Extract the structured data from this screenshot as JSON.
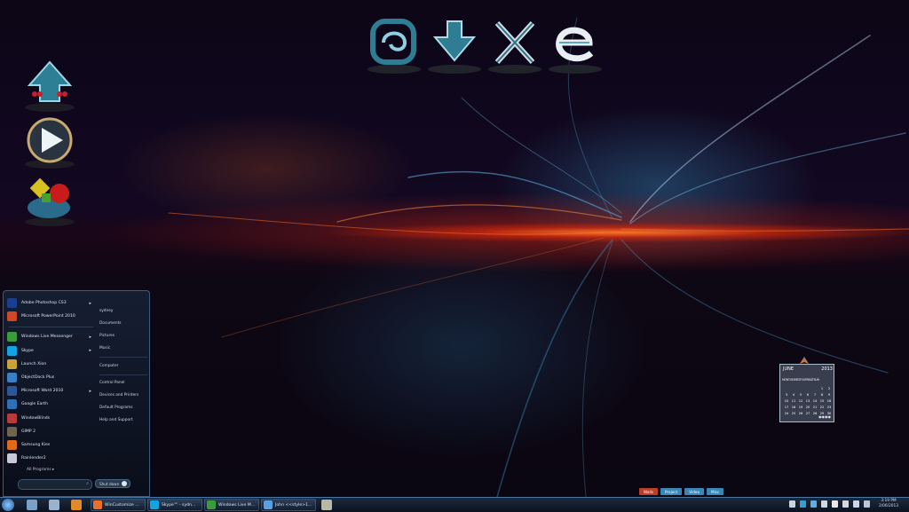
{
  "desktop": {
    "left_icons": [
      "upload-icon",
      "play-icon",
      "game-icon"
    ],
    "dock_icons": [
      "launch-icon",
      "download-icon",
      "crossed-tools-icon",
      "browser-e-icon"
    ]
  },
  "start_menu": {
    "programs": [
      {
        "label": "Adobe Photoshop CS3",
        "icon": "photoshop-icon",
        "color": "#1b3f8f",
        "submenu": true
      },
      {
        "label": "Microsoft PowerPoint 2010",
        "icon": "powerpoint-icon",
        "color": "#d24726",
        "submenu": false
      },
      {
        "label": "Windows Live Messenger",
        "icon": "messenger-icon",
        "color": "#3a9c3a",
        "submenu": true
      },
      {
        "label": "Skype",
        "icon": "skype-icon",
        "color": "#12a5e3",
        "submenu": true
      },
      {
        "label": "Launch Xion",
        "icon": "xion-icon",
        "color": "#c9a33a",
        "submenu": false
      },
      {
        "label": "ObjectDock Plus",
        "icon": "objectdock-icon",
        "color": "#3a7fc4",
        "submenu": false
      },
      {
        "label": "Microsoft Word 2010",
        "icon": "word-icon",
        "color": "#2b5797",
        "submenu": true
      },
      {
        "label": "Google Earth",
        "icon": "google-earth-icon",
        "color": "#2f6fb6",
        "submenu": false
      },
      {
        "label": "WindowBlinds",
        "icon": "windowblinds-icon",
        "color": "#b83a3a",
        "submenu": false
      },
      {
        "label": "GIMP 2",
        "icon": "gimp-icon",
        "color": "#6e6450",
        "submenu": false
      },
      {
        "label": "Samsung Kies",
        "icon": "samsung-kies-icon",
        "color": "#e06a1a",
        "submenu": false
      },
      {
        "label": "Rainlender2",
        "icon": "rainlendar-icon",
        "color": "#c8c8d8",
        "submenu": false
      }
    ],
    "places": [
      "sydney",
      "Documents",
      "Pictures",
      "Music",
      "Computer",
      "Control Panel",
      "Devices and Printers",
      "Default Programs",
      "Help and Support"
    ],
    "all_programs": "All Programs",
    "shutdown": "Shut down"
  },
  "taskbar": {
    "pinned": [
      {
        "icon": "quick-launch-icon",
        "color": "#7aa0c8"
      },
      {
        "icon": "library-icon",
        "color": "#9ab4d0"
      },
      {
        "icon": "media-player-icon",
        "color": "#e08a2a"
      }
    ],
    "buttons": [
      {
        "label": "WinCustomize ...",
        "icon": "firefox-icon",
        "color": "#e8702a"
      },
      {
        "label": "Skype™ - sydn...",
        "icon": "skype-icon",
        "color": "#12a5e3"
      },
      {
        "label": "Windows Live M...",
        "icon": "messenger-icon",
        "color": "#3a9c3a"
      },
      {
        "label": "John <<style>1...",
        "icon": "messenger-contact-icon",
        "color": "#5aa0e0"
      }
    ],
    "extra_icon": "notepad-icon",
    "tray": [
      "chevron-up-icon",
      "flag-icon",
      "network-icon",
      "volume-icon",
      "shield-icon",
      "device-icon",
      "speaker-icon",
      "battery-icon"
    ],
    "clock_time": "3:19 PM",
    "clock_date": "2/06/2013"
  },
  "tags": [
    {
      "label": "Walls",
      "color": "#b8402a"
    },
    {
      "label": "Project",
      "color": "#3a86b8"
    },
    {
      "label": "Video",
      "color": "#3a86b8"
    },
    {
      "label": "Misc",
      "color": "#3a86b8"
    }
  ],
  "calendar": {
    "month": "JUNE",
    "year": "2013",
    "weekdays": "MONTUEWEDTHUFRISATSUN",
    "days": [
      "",
      "",
      "",
      "",
      "",
      "1",
      "2",
      "3",
      "4",
      "5",
      "6",
      "7",
      "8",
      "9",
      "10",
      "11",
      "12",
      "13",
      "14",
      "15",
      "16",
      "17",
      "18",
      "19",
      "20",
      "21",
      "22",
      "23",
      "24",
      "25",
      "26",
      "27",
      "28",
      "29",
      "30"
    ]
  }
}
